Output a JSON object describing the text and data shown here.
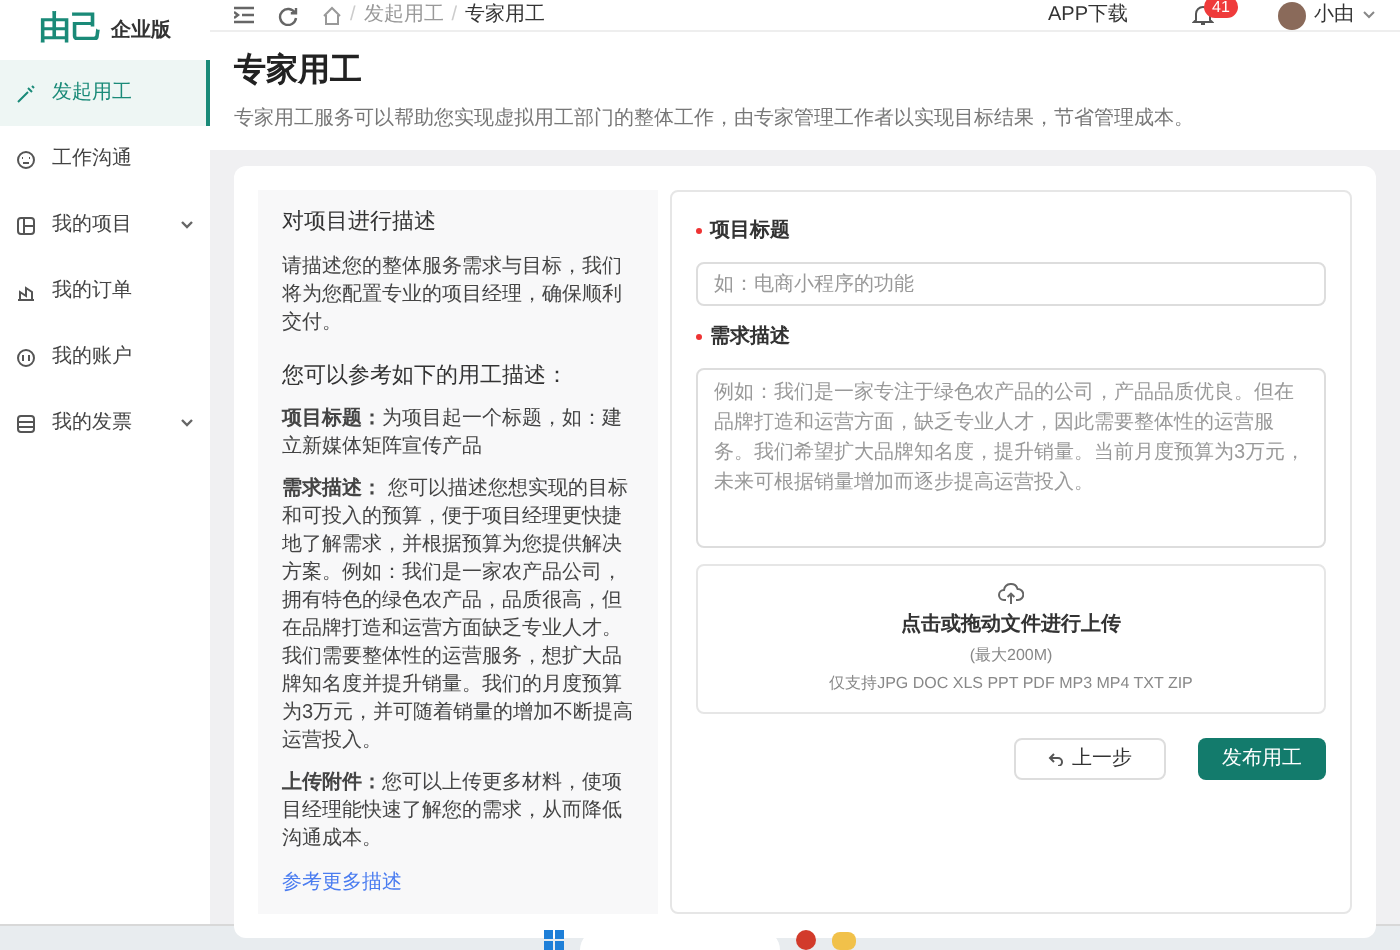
{
  "logo": {
    "name": "由己",
    "edition": "企业版"
  },
  "sidebar": {
    "items": [
      {
        "label": "发起用工",
        "selected": true,
        "kind": "link"
      },
      {
        "label": "工作沟通",
        "selected": false,
        "kind": "link"
      },
      {
        "label": "我的项目",
        "selected": false,
        "kind": "group"
      },
      {
        "label": "我的订单",
        "selected": false,
        "kind": "link"
      },
      {
        "label": "我的账户",
        "selected": false,
        "kind": "link"
      },
      {
        "label": "我的发票",
        "selected": false,
        "kind": "group"
      }
    ]
  },
  "header": {
    "breadcrumb": [
      {
        "separator": "/",
        "label": "发起用工"
      },
      {
        "separator": "/",
        "label": "专家用工"
      }
    ],
    "app_download": "APP下载",
    "notification_count": "41",
    "user_name": "小由"
  },
  "page": {
    "title": "专家用工",
    "subtitle": "专家用工服务可以帮助您实现虚拟用工部门的整体工作，由专家管理工作者以实现目标结果，节省管理成本。"
  },
  "guide": {
    "title": "对项目进行描述",
    "intro": "请描述您的整体服务需求与目标，我们将为您配置专业的项目经理，确保顺利交付。",
    "examples_title": "您可以参考如下的用工描述：",
    "examples": [
      "**项目标题：**为项目起一个标题，如：建立新媒体矩阵宣传产品",
      "**需求描述：** 您可以描述您想实现的目标和可投入的预算，便于项目经理更快捷地了解需求，并根据预算为您提供解决方案。例如：我们是一家农产品公司，拥有特色的绿色农产品，品质很高，但在品牌打造和运营方面缺乏专业人才。我们需要整体性的运营服务，想扩大品牌知名度并提升销量。我们的月度预算为3万元，并可随着销量的增加不断提高运营投入。",
      "**上传附件：**您可以上传更多材料，使项目经理能快速了解您的需求，从而降低沟通成本。"
    ],
    "more_link": "参考更多描述"
  },
  "form": {
    "fields": [
      {
        "label": "项目标题",
        "required": true,
        "kind": "input",
        "placeholder": "如：电商小程序的功能"
      },
      {
        "label": "需求描述",
        "required": true,
        "kind": "textarea",
        "placeholder": "例如：我们是一家专注于绿色农产品的公司，产品品质优良。但在品牌打造和运营方面，缺乏专业人才，因此需要整体性的运营服务。我们希望扩大品牌知名度，提升销量。当前月度预算为3万元，未来可根据销量增加而逐步提高运营投入。"
      }
    ],
    "upload": {
      "title": "点击或拖动文件进行上传",
      "limit": "(最大200M)",
      "formats": "仅支持JPG DOC XLS PPT PDF MP3 MP4 TXT ZIP"
    },
    "buttons": [
      {
        "label": "上一步",
        "kind": "back"
      },
      {
        "label": "发布用工",
        "kind": "primary"
      }
    ]
  }
}
